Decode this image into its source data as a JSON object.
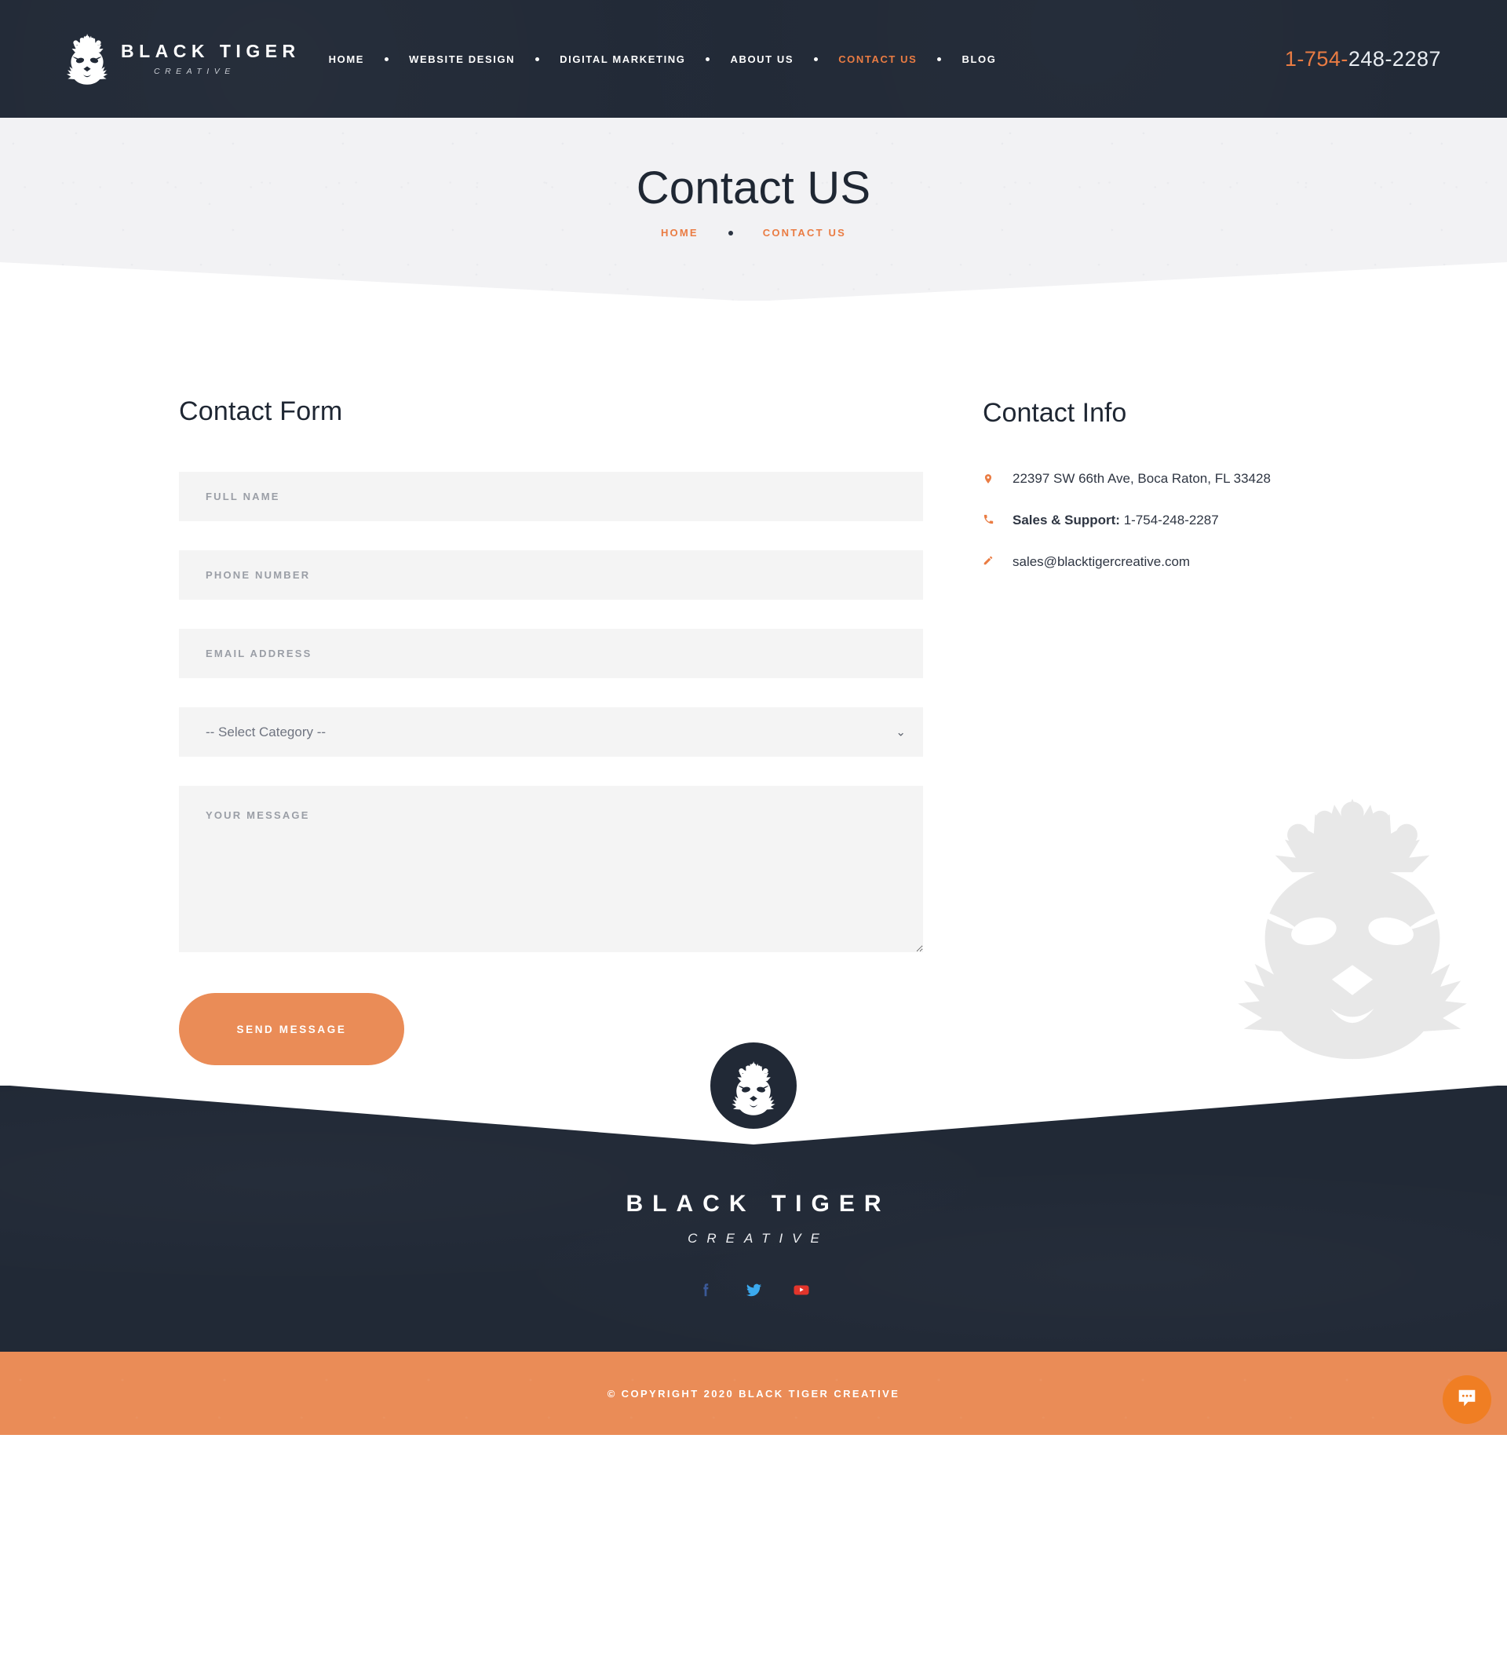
{
  "header": {
    "brand": {
      "name": "BLACK TIGER",
      "tagline": "CREATIVE",
      "logo_icon": "tiger-crown-logo"
    },
    "nav": [
      {
        "label": "HOME",
        "active": false
      },
      {
        "label": "WEBSITE DESIGN",
        "active": false
      },
      {
        "label": "DIGITAL MARKETING",
        "active": false
      },
      {
        "label": "ABOUT US",
        "active": false
      },
      {
        "label": "CONTACT US",
        "active": true
      },
      {
        "label": "BLOG",
        "active": false
      }
    ],
    "phone_prefix": "1-754-",
    "phone_suffix": "248-2287",
    "phone_full": "1-754-248-2287"
  },
  "hero": {
    "title": "Contact US",
    "breadcrumb": {
      "home": "HOME",
      "current": "CONTACT US"
    }
  },
  "form": {
    "title": "Contact Form",
    "full_name_placeholder": "FULL NAME",
    "phone_placeholder": "PHONE NUMBER",
    "email_placeholder": "EMAIL ADDRESS",
    "category_selected": "-- Select Category --",
    "category_options": [
      "-- Select Category --"
    ],
    "message_placeholder": "YOUR MESSAGE",
    "submit_label": "SEND MESSAGE"
  },
  "info": {
    "title": "Contact Info",
    "address": "22397 SW 66th Ave, Boca Raton, FL 33428",
    "phone_label": "Sales & Support:",
    "phone_value": " 1-754-248-2287",
    "email": "sales@blacktigercreative.com"
  },
  "footer": {
    "name": "BLACK TIGER",
    "tagline": "CREATIVE",
    "socials": [
      {
        "name": "facebook",
        "glyph": "f",
        "color": "#3b5998"
      },
      {
        "name": "twitter",
        "glyph": "t",
        "color": "#3ba9ee"
      },
      {
        "name": "youtube",
        "glyph": "y",
        "color": "#e2352b"
      }
    ]
  },
  "copyright": {
    "text": "© COPYRIGHT 2020 BLACK TIGER CREATIVE"
  },
  "chat": {
    "icon": "chat-bubble-icon"
  },
  "colors": {
    "accent": "#ea7c43",
    "accent_button": "#ea8c57",
    "dark": "#212936",
    "field_bg": "#f4f4f4",
    "hero_bg": "#f2f2f4"
  }
}
